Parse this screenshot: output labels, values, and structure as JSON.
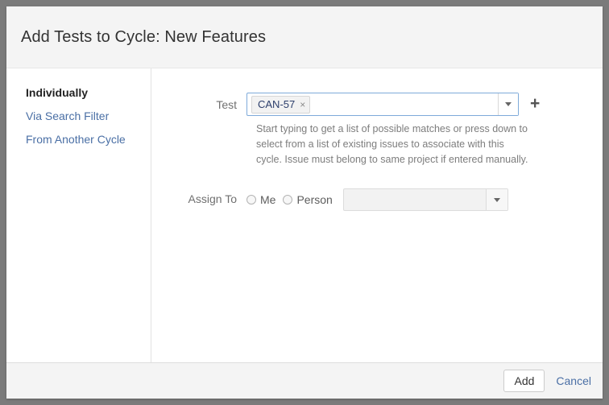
{
  "dialog": {
    "title": "Add Tests to Cycle: New Features"
  },
  "sidebar": {
    "items": [
      {
        "label": "Individually",
        "active": true
      },
      {
        "label": "Via Search Filter",
        "active": false
      },
      {
        "label": "From Another Cycle",
        "active": false
      }
    ]
  },
  "form": {
    "test": {
      "label": "Test",
      "tags": [
        {
          "text": "CAN-57",
          "remove": "×"
        }
      ],
      "add_icon": "plus-icon",
      "caret_icon": "chevron-down-icon",
      "help_text": "Start typing to get a list of possible matches or press down to select from a list of existing issues to associate with this cycle. Issue must belong to same project if entered manually."
    },
    "assign_to": {
      "label": "Assign To",
      "options": [
        {
          "label": "Me",
          "selected": false
        },
        {
          "label": "Person",
          "selected": false
        }
      ],
      "person_select_value": "",
      "caret_icon": "chevron-down-icon"
    }
  },
  "footer": {
    "add_label": "Add",
    "cancel_label": "Cancel"
  },
  "colors": {
    "page_background": "#7b7b7b",
    "dialog_background": "#ffffff",
    "header_background": "#f4f4f4",
    "link": "#4a6fa5",
    "focus_border": "#7eaada",
    "tag_text": "#2c3e6b",
    "help_text": "#7d7d7d"
  }
}
